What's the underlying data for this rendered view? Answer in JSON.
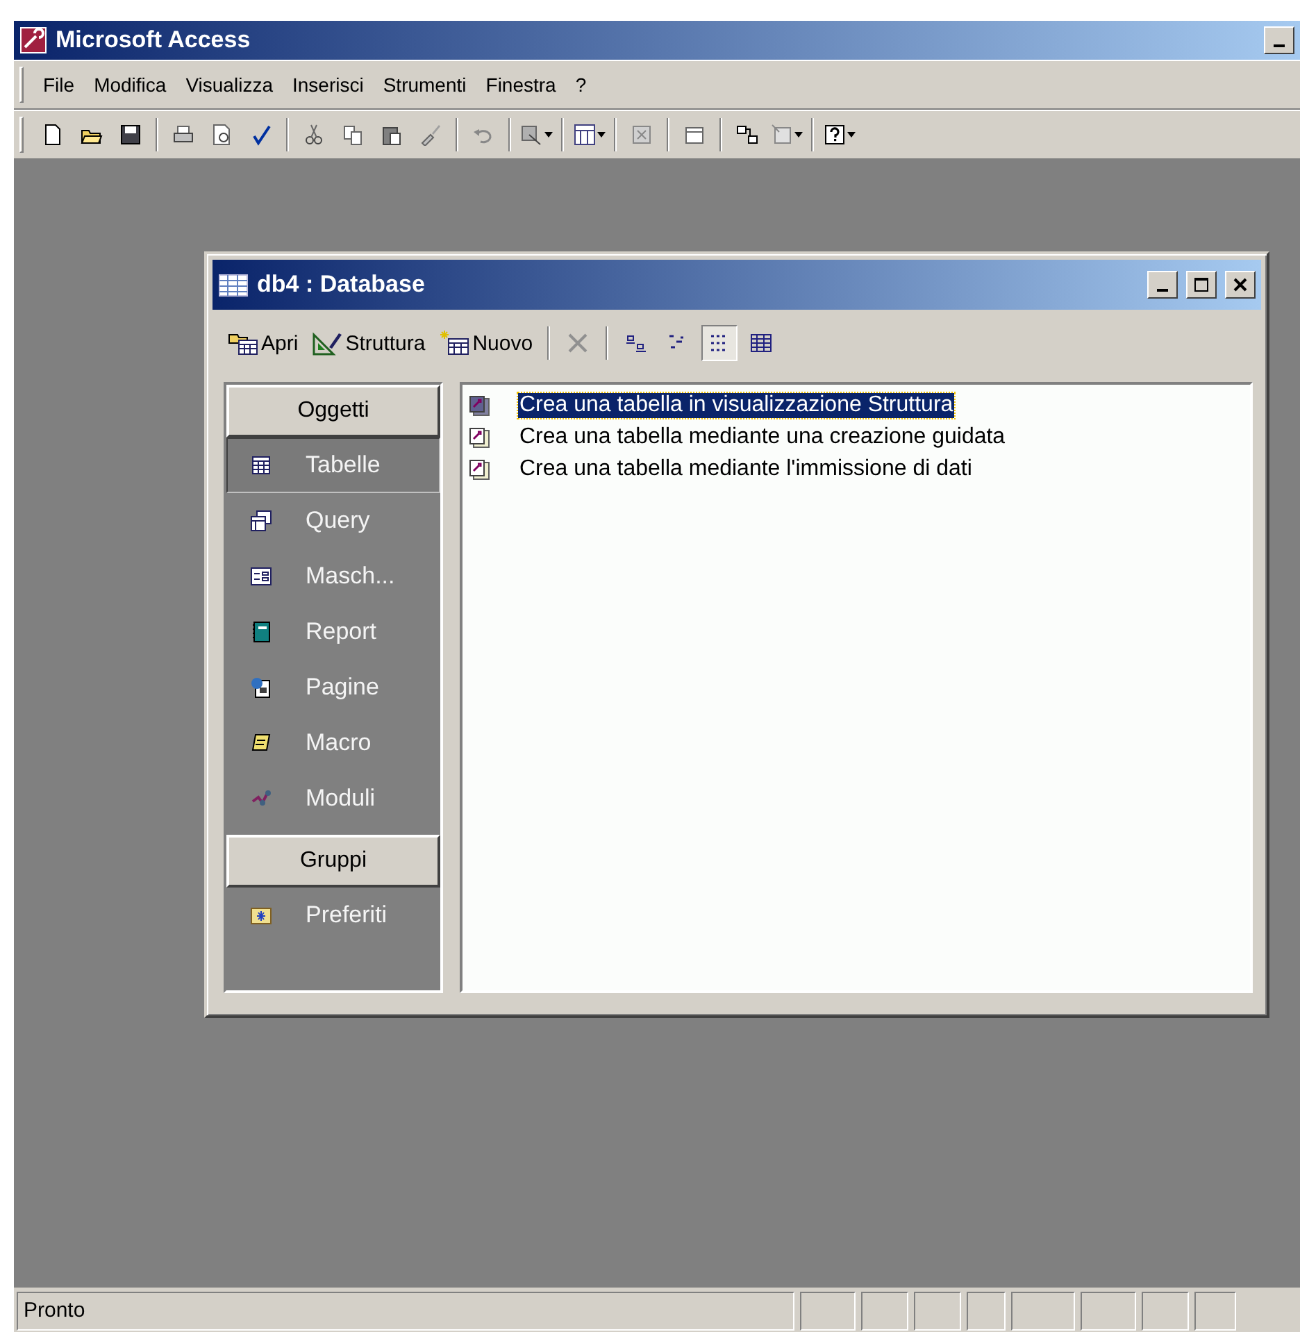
{
  "app": {
    "title": "Microsoft Access"
  },
  "menu": [
    {
      "label": "File"
    },
    {
      "label": "Modifica"
    },
    {
      "label": "Visualizza"
    },
    {
      "label": "Inserisci"
    },
    {
      "label": "Strumenti"
    },
    {
      "label": "Finestra"
    },
    {
      "label": "?"
    }
  ],
  "db_window": {
    "title": "db4 : Database",
    "toolbar": [
      {
        "label": "Apri",
        "kind": "open"
      },
      {
        "label": "Struttura",
        "kind": "design"
      },
      {
        "label": "Nuovo",
        "kind": "new"
      }
    ],
    "view_modes": [
      {
        "kind": "large",
        "selected": false
      },
      {
        "kind": "small",
        "selected": false
      },
      {
        "kind": "list",
        "selected": true
      },
      {
        "kind": "details",
        "selected": false
      }
    ],
    "objects_header": "Oggetti",
    "objects": [
      {
        "label": "Tabelle",
        "kind": "table",
        "selected": true
      },
      {
        "label": "Query",
        "kind": "query",
        "selected": false
      },
      {
        "label": "Masch...",
        "kind": "form",
        "selected": false
      },
      {
        "label": "Report",
        "kind": "report",
        "selected": false
      },
      {
        "label": "Pagine",
        "kind": "page",
        "selected": false
      },
      {
        "label": "Macro",
        "kind": "macro",
        "selected": false
      },
      {
        "label": "Moduli",
        "kind": "module",
        "selected": false
      }
    ],
    "groups_header": "Gruppi",
    "groups": [
      {
        "label": "Preferiti",
        "kind": "favorites",
        "selected": false
      }
    ],
    "items": [
      {
        "label": "Crea una tabella in visualizzazione Struttura",
        "selected": true
      },
      {
        "label": "Crea una tabella mediante una creazione guidata",
        "selected": false
      },
      {
        "label": "Crea una tabella mediante l'immissione di dati",
        "selected": false
      }
    ]
  },
  "status_bar": {
    "text": "Pronto"
  }
}
